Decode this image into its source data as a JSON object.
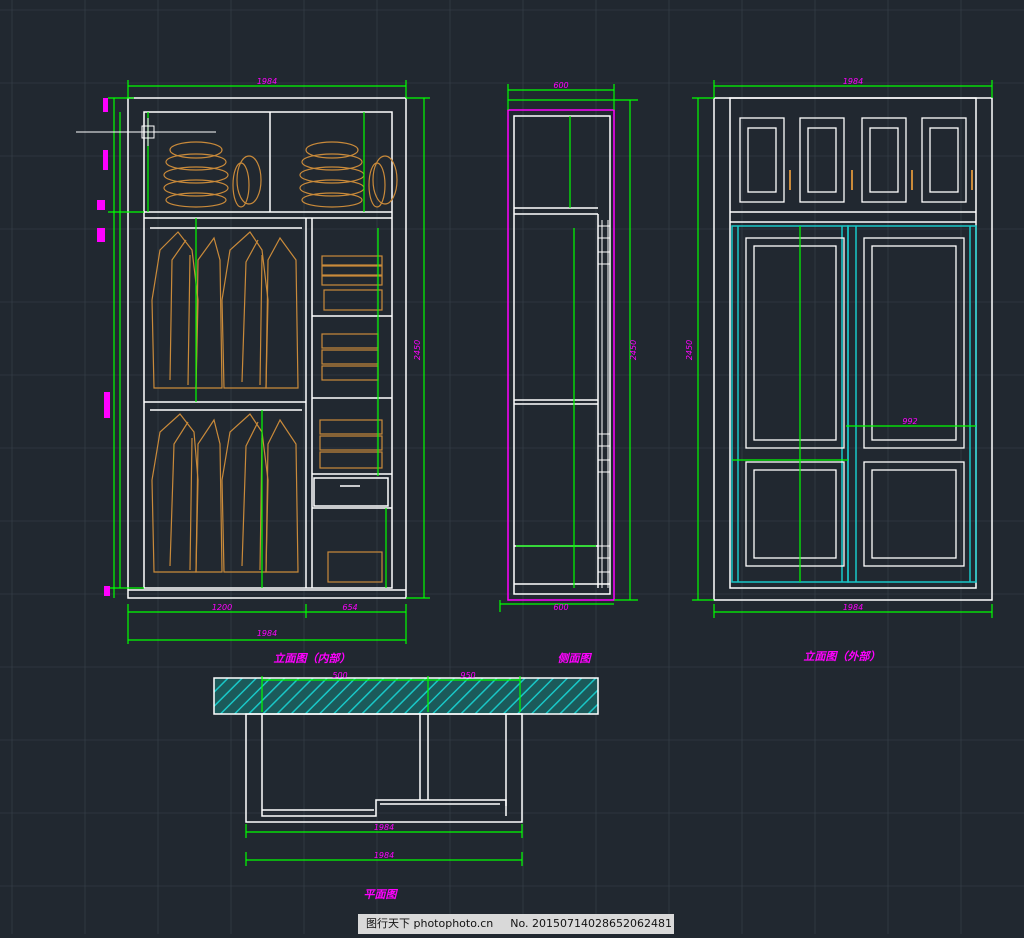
{
  "colors": {
    "background": "#212830",
    "grid": "#3a434d",
    "outline": "#ffffff",
    "dimension": "#00ff00",
    "annotation": "#ff00ff",
    "clothing": "#c98a3a",
    "door_frame": "#19c7c7",
    "hatch": "#19c7c7"
  },
  "labels": {
    "front_inner_view": "立面图（内部）",
    "side_view": "侧面图",
    "front_outer_view": "立面图（外部）",
    "plan_view": "平面图"
  },
  "dimensions": {
    "front_inner_width_top": "1984",
    "front_inner_width_bottom": "1984",
    "front_inner_left_section": "1200",
    "front_inner_right_section": "654",
    "front_inner_height": "2450",
    "side_width_top": "600",
    "side_width_bottom": "600",
    "side_height": "2450",
    "front_outer_width_top": "1984",
    "front_outer_width_bottom": "1984",
    "front_outer_height": "2450",
    "door_width": "992",
    "plan_width_1": "1984",
    "plan_width_2": "1984",
    "plan_top_left": "500",
    "plan_top_right": "950"
  },
  "watermark": {
    "site": "图行天下 photophoto.cn",
    "number": "No. 20150714028652062481"
  }
}
